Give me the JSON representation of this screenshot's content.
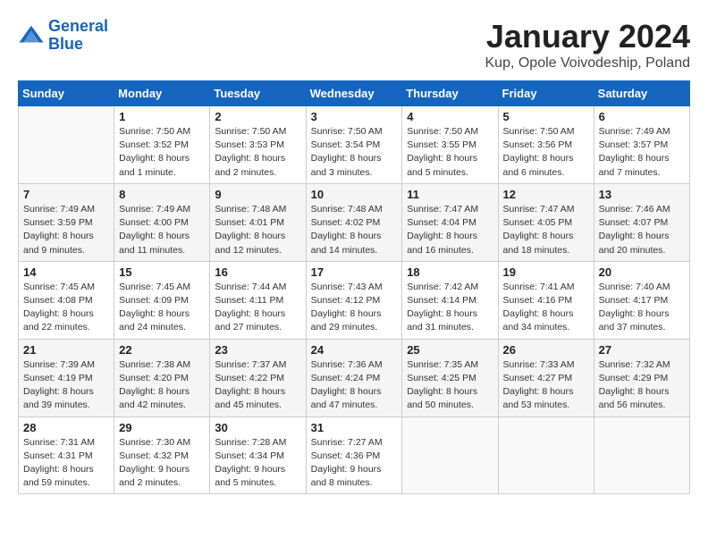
{
  "header": {
    "logo_line1": "General",
    "logo_line2": "Blue",
    "month": "January 2024",
    "location": "Kup, Opole Voivodeship, Poland"
  },
  "days_of_week": [
    "Sunday",
    "Monday",
    "Tuesday",
    "Wednesday",
    "Thursday",
    "Friday",
    "Saturday"
  ],
  "weeks": [
    [
      {
        "day": "",
        "detail": ""
      },
      {
        "day": "1",
        "detail": "Sunrise: 7:50 AM\nSunset: 3:52 PM\nDaylight: 8 hours\nand 1 minute."
      },
      {
        "day": "2",
        "detail": "Sunrise: 7:50 AM\nSunset: 3:53 PM\nDaylight: 8 hours\nand 2 minutes."
      },
      {
        "day": "3",
        "detail": "Sunrise: 7:50 AM\nSunset: 3:54 PM\nDaylight: 8 hours\nand 3 minutes."
      },
      {
        "day": "4",
        "detail": "Sunrise: 7:50 AM\nSunset: 3:55 PM\nDaylight: 8 hours\nand 5 minutes."
      },
      {
        "day": "5",
        "detail": "Sunrise: 7:50 AM\nSunset: 3:56 PM\nDaylight: 8 hours\nand 6 minutes."
      },
      {
        "day": "6",
        "detail": "Sunrise: 7:49 AM\nSunset: 3:57 PM\nDaylight: 8 hours\nand 7 minutes."
      }
    ],
    [
      {
        "day": "7",
        "detail": "Sunrise: 7:49 AM\nSunset: 3:59 PM\nDaylight: 8 hours\nand 9 minutes."
      },
      {
        "day": "8",
        "detail": "Sunrise: 7:49 AM\nSunset: 4:00 PM\nDaylight: 8 hours\nand 11 minutes."
      },
      {
        "day": "9",
        "detail": "Sunrise: 7:48 AM\nSunset: 4:01 PM\nDaylight: 8 hours\nand 12 minutes."
      },
      {
        "day": "10",
        "detail": "Sunrise: 7:48 AM\nSunset: 4:02 PM\nDaylight: 8 hours\nand 14 minutes."
      },
      {
        "day": "11",
        "detail": "Sunrise: 7:47 AM\nSunset: 4:04 PM\nDaylight: 8 hours\nand 16 minutes."
      },
      {
        "day": "12",
        "detail": "Sunrise: 7:47 AM\nSunset: 4:05 PM\nDaylight: 8 hours\nand 18 minutes."
      },
      {
        "day": "13",
        "detail": "Sunrise: 7:46 AM\nSunset: 4:07 PM\nDaylight: 8 hours\nand 20 minutes."
      }
    ],
    [
      {
        "day": "14",
        "detail": "Sunrise: 7:45 AM\nSunset: 4:08 PM\nDaylight: 8 hours\nand 22 minutes."
      },
      {
        "day": "15",
        "detail": "Sunrise: 7:45 AM\nSunset: 4:09 PM\nDaylight: 8 hours\nand 24 minutes."
      },
      {
        "day": "16",
        "detail": "Sunrise: 7:44 AM\nSunset: 4:11 PM\nDaylight: 8 hours\nand 27 minutes."
      },
      {
        "day": "17",
        "detail": "Sunrise: 7:43 AM\nSunset: 4:12 PM\nDaylight: 8 hours\nand 29 minutes."
      },
      {
        "day": "18",
        "detail": "Sunrise: 7:42 AM\nSunset: 4:14 PM\nDaylight: 8 hours\nand 31 minutes."
      },
      {
        "day": "19",
        "detail": "Sunrise: 7:41 AM\nSunset: 4:16 PM\nDaylight: 8 hours\nand 34 minutes."
      },
      {
        "day": "20",
        "detail": "Sunrise: 7:40 AM\nSunset: 4:17 PM\nDaylight: 8 hours\nand 37 minutes."
      }
    ],
    [
      {
        "day": "21",
        "detail": "Sunrise: 7:39 AM\nSunset: 4:19 PM\nDaylight: 8 hours\nand 39 minutes."
      },
      {
        "day": "22",
        "detail": "Sunrise: 7:38 AM\nSunset: 4:20 PM\nDaylight: 8 hours\nand 42 minutes."
      },
      {
        "day": "23",
        "detail": "Sunrise: 7:37 AM\nSunset: 4:22 PM\nDaylight: 8 hours\nand 45 minutes."
      },
      {
        "day": "24",
        "detail": "Sunrise: 7:36 AM\nSunset: 4:24 PM\nDaylight: 8 hours\nand 47 minutes."
      },
      {
        "day": "25",
        "detail": "Sunrise: 7:35 AM\nSunset: 4:25 PM\nDaylight: 8 hours\nand 50 minutes."
      },
      {
        "day": "26",
        "detail": "Sunrise: 7:33 AM\nSunset: 4:27 PM\nDaylight: 8 hours\nand 53 minutes."
      },
      {
        "day": "27",
        "detail": "Sunrise: 7:32 AM\nSunset: 4:29 PM\nDaylight: 8 hours\nand 56 minutes."
      }
    ],
    [
      {
        "day": "28",
        "detail": "Sunrise: 7:31 AM\nSunset: 4:31 PM\nDaylight: 8 hours\nand 59 minutes."
      },
      {
        "day": "29",
        "detail": "Sunrise: 7:30 AM\nSunset: 4:32 PM\nDaylight: 9 hours\nand 2 minutes."
      },
      {
        "day": "30",
        "detail": "Sunrise: 7:28 AM\nSunset: 4:34 PM\nDaylight: 9 hours\nand 5 minutes."
      },
      {
        "day": "31",
        "detail": "Sunrise: 7:27 AM\nSunset: 4:36 PM\nDaylight: 9 hours\nand 8 minutes."
      },
      {
        "day": "",
        "detail": ""
      },
      {
        "day": "",
        "detail": ""
      },
      {
        "day": "",
        "detail": ""
      }
    ]
  ]
}
